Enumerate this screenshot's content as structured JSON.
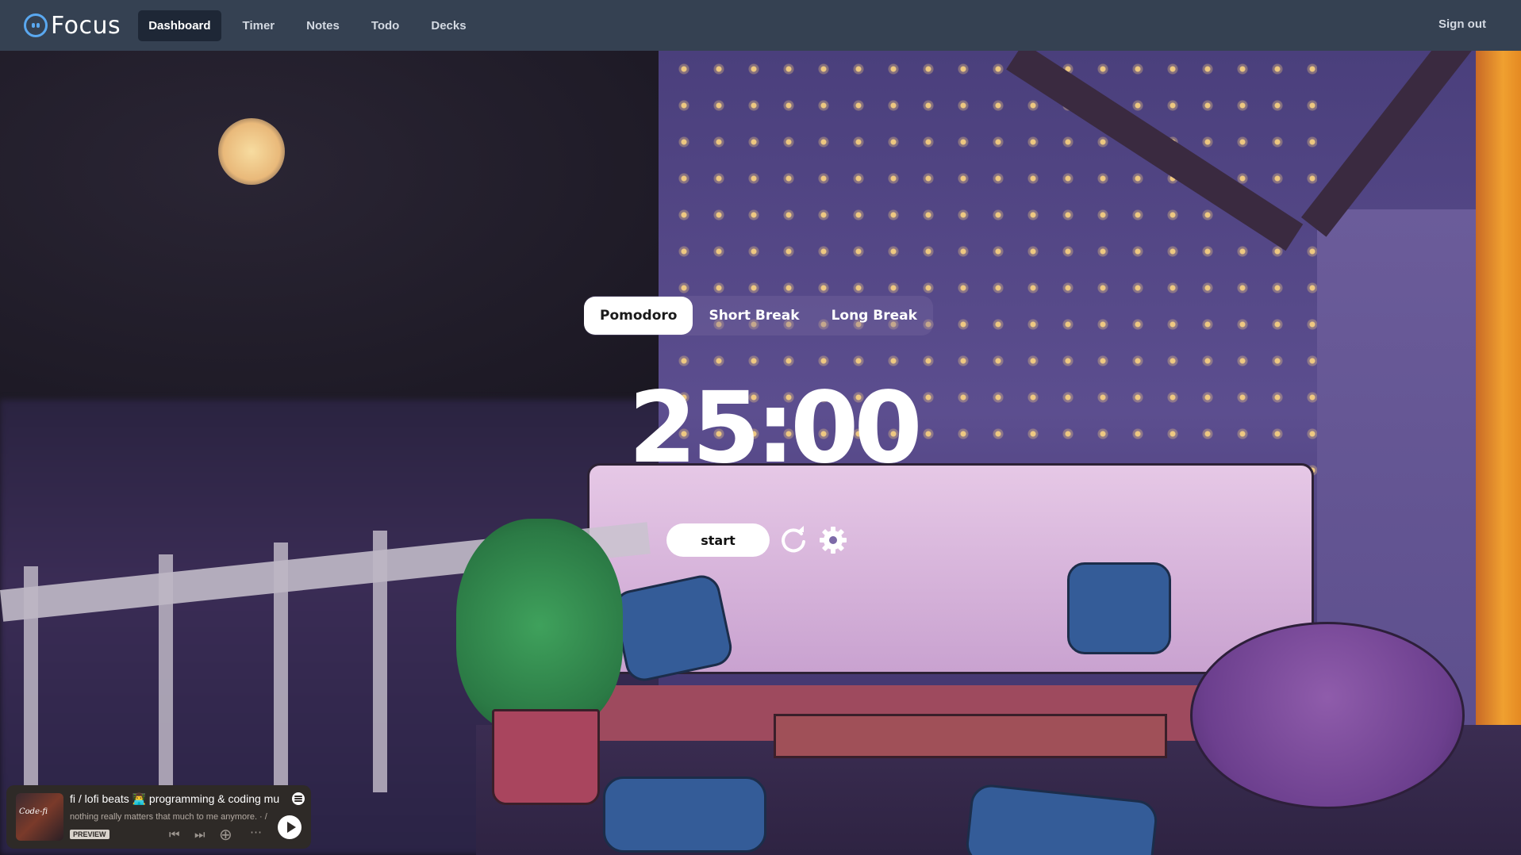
{
  "app": {
    "name": "Focus"
  },
  "nav": {
    "items": [
      {
        "label": "Dashboard",
        "active": true
      },
      {
        "label": "Timer",
        "active": false
      },
      {
        "label": "Notes",
        "active": false
      },
      {
        "label": "Todo",
        "active": false
      },
      {
        "label": "Decks",
        "active": false
      }
    ],
    "sign_out": "Sign out"
  },
  "timer": {
    "modes": [
      {
        "label": "Pomodoro",
        "active": true
      },
      {
        "label": "Short Break",
        "active": false
      },
      {
        "label": "Long Break",
        "active": false
      }
    ],
    "display": "25:00",
    "start_label": "start",
    "reset_icon": "refresh-icon",
    "settings_icon": "gear-icon"
  },
  "player": {
    "title": "fi / lofi beats 👨‍💻 programming & coding mu",
    "subtitle": "nothing really matters that much to me anymore. · /",
    "badge": "PREVIEW",
    "art_text": "Code-fi",
    "icons": [
      "spotify-icon",
      "previous-icon",
      "next-icon",
      "add-icon",
      "more-icon",
      "play-icon"
    ]
  },
  "colors": {
    "topbar": "#354152",
    "active_nav": "#1e2736",
    "logo_accent": "#5aa8f0",
    "player_bg": "#2e2a27"
  }
}
